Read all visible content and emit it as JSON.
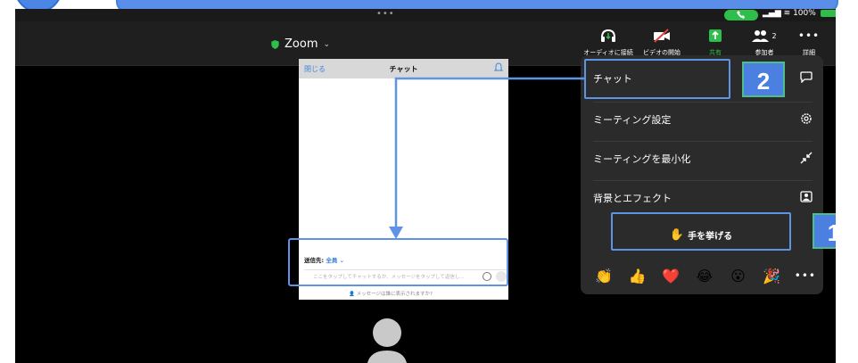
{
  "status_bar": {
    "top_dots": "•••",
    "battery_percent": "100%"
  },
  "toolbar": {
    "meeting_title": "Zoom",
    "items": [
      {
        "label": "オーディオに接続",
        "icon": "headphones-icon"
      },
      {
        "label": "ビデオの開始",
        "icon": "video-off-icon"
      },
      {
        "label": "共有",
        "icon": "share-icon"
      },
      {
        "label": "参加者",
        "icon": "participants-icon",
        "count": "2"
      },
      {
        "label": "詳細",
        "icon": "more-icon"
      }
    ]
  },
  "chat_panel": {
    "close_label": "閉じる",
    "title": "チャット",
    "recipient_label": "送信先:",
    "recipient_value": "全員",
    "input_placeholder": "ここをタップしてチャットするか、メッセージをタップして返信し...",
    "notice": "メッセージは誰に表示されますか?"
  },
  "more_menu": {
    "items": [
      {
        "label": "チャット",
        "icon": "chat-bubble-icon"
      },
      {
        "label": "ミーティング設定",
        "icon": "gear-icon"
      },
      {
        "label": "ミーティングを最小化",
        "icon": "minimize-icon"
      },
      {
        "label": "背景とエフェクト",
        "icon": "portrait-icon"
      }
    ],
    "raise_hand_label": "手を挙げる",
    "reactions": [
      "👏",
      "👍",
      "❤️",
      "😂",
      "😮",
      "🎉"
    ],
    "reactions_more": "•••"
  },
  "annotations": {
    "step_1": "1",
    "step_2": "2"
  },
  "colors": {
    "accent_blue": "#5f93e6",
    "badge_blue": "#4b7fe0",
    "share_green": "#2dbf4a"
  }
}
